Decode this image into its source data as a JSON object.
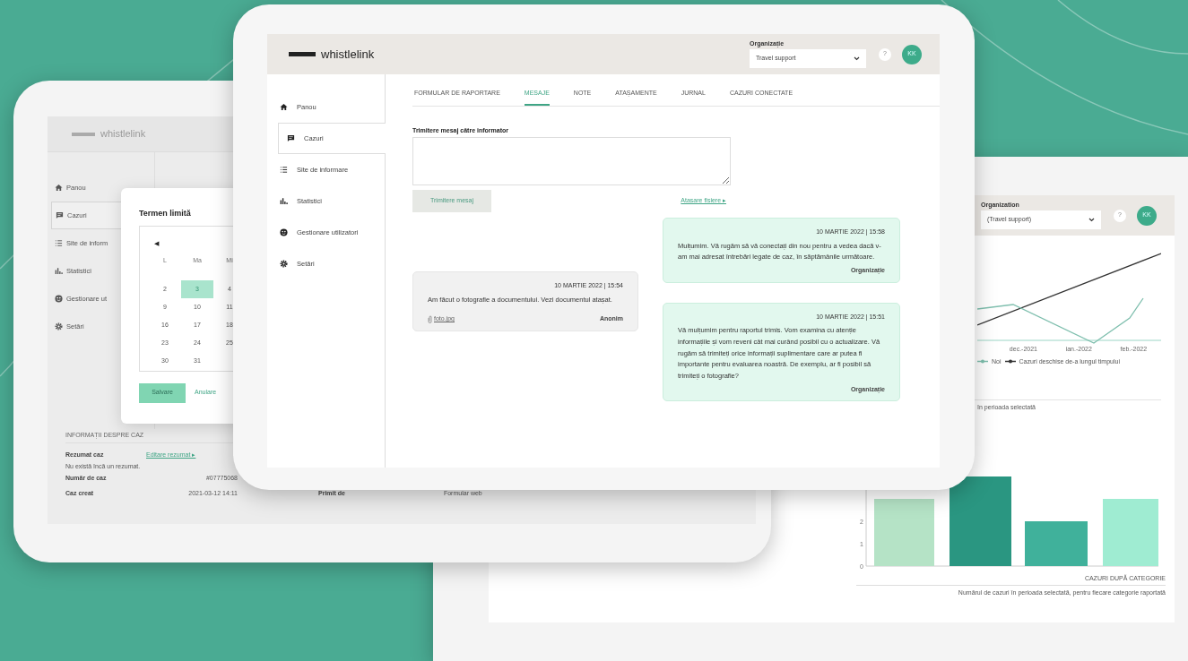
{
  "left_tablet": {
    "logo": "whistlelink",
    "sidebar": [
      {
        "label": "Panou",
        "selected": false
      },
      {
        "label": "Cazuri",
        "selected": true
      },
      {
        "label": "Site de inform",
        "selected": false
      },
      {
        "label": "Statistici",
        "selected": false
      },
      {
        "label": "Gestionare ut",
        "selected": false
      },
      {
        "label": "Setări",
        "selected": false
      }
    ],
    "dialog": {
      "title": "Termen limită",
      "prev": "◀",
      "weekdays": [
        "L",
        "Ma",
        "Mi"
      ],
      "weeks": [
        [
          {
            "day": "2",
            "selected": false
          },
          {
            "day": "3",
            "selected": true
          },
          {
            "day": "4",
            "selected": false
          }
        ],
        [
          {
            "day": "9",
            "selected": false
          },
          {
            "day": "10",
            "selected": false
          },
          {
            "day": "11",
            "selected": false
          }
        ],
        [
          {
            "day": "16",
            "selected": false
          },
          {
            "day": "17",
            "selected": false
          },
          {
            "day": "18",
            "selected": false
          }
        ],
        [
          {
            "day": "23",
            "selected": false
          },
          {
            "day": "24",
            "selected": false
          },
          {
            "day": "25",
            "selected": false
          }
        ],
        [
          {
            "day": "30",
            "selected": false
          },
          {
            "day": "31",
            "selected": false
          }
        ]
      ],
      "buttons": [
        {
          "label": "Salvare",
          "kind": "primary"
        },
        {
          "label": "Anulare",
          "kind": "link"
        }
      ]
    },
    "case_info": {
      "heading": "INFORMAȚII DESPRE CAZ",
      "summary_label": "Rezumat caz",
      "summary_link": "Editare rezumat ▸",
      "summary_note": "Nu există încă un rezumat.",
      "fields": [
        {
          "label": "Număr de caz",
          "value": "#07775068"
        },
        {
          "label": "Caz creat",
          "value": "2021-03-12 14:11"
        }
      ],
      "received": {
        "label": "Primit de",
        "value": "Formular web"
      }
    }
  },
  "front_tablet": {
    "logo": "whistlelink",
    "organization": {
      "label": "Organizație",
      "value": "Travel support"
    },
    "help": "?",
    "avatar": "KK",
    "sidebar": [
      {
        "label": "Panou",
        "selected": false
      },
      {
        "label": "Cazuri",
        "selected": true
      },
      {
        "label": "Site de informare",
        "selected": false
      },
      {
        "label": "Statistici",
        "selected": false
      },
      {
        "label": "Gestionare utilizatori",
        "selected": false
      },
      {
        "label": "Setări",
        "selected": false
      }
    ],
    "tabs": [
      {
        "label": "FORMULAR DE RAPORTARE",
        "selected": false
      },
      {
        "label": "MESAJE",
        "selected": true
      },
      {
        "label": "NOTE",
        "selected": false
      },
      {
        "label": "ATAȘAMENTE",
        "selected": false
      },
      {
        "label": "JURNAL",
        "selected": false
      },
      {
        "label": "CAZURI CONECTATE",
        "selected": false
      }
    ],
    "compose": {
      "label": "Trimitere mesaj către informator",
      "button": "Trimitere mesaj",
      "attach_link": "Atașare fișiere ▸"
    },
    "messages": [
      {
        "kind": "organization",
        "date": "10 MARTIE 2022 | 15:58",
        "text": "Mulțumim. Vă rugăm să vă conectați din nou pentru a vedea dacă v-am mai adresat întrebări legate de caz, în săptămânile următoare.",
        "sender": "Organizație"
      },
      {
        "kind": "anonymous",
        "date": "10 MARTIE 2022 | 15:54",
        "text": "Am făcut o fotografie a documentului. Vezi documentul atașat.",
        "attachment": "foto.jpg",
        "sender": "Anonim"
      },
      {
        "kind": "organization",
        "date": "10 MARTIE 2022 | 15:51",
        "text": "Vă mulțumim pentru raportul trimis. Vom examina cu atenție informațiile și vom reveni cât mai curând posibil cu o actualizare. Vă rugăm să trimiteți orice informații suplimentare care ar putea fi importante pentru evaluarea noastră. De exemplu, ar fi posibil să trimiteți o fotografie?",
        "sender": "Organizație"
      }
    ]
  },
  "right_tablet": {
    "organization": {
      "label": "Organization",
      "value": "(Travel support)"
    },
    "help": "?",
    "avatar": "KK",
    "trend_chart": {
      "x_labels": [
        "dec.-2021",
        "ian.-2022",
        "feb.-2022"
      ],
      "legend": [
        {
          "label": "Noi",
          "color": "#7fbfae"
        },
        {
          "label": "Cazuri deschise de-a lungul timpului",
          "color": "#333333"
        }
      ]
    },
    "category_chart": {
      "chart_data": {
        "type": "bar",
        "title": "în perioada selectată",
        "xlabel": "CAZURI DUPĂ CATEGORIE",
        "values": [
          3,
          4,
          2,
          3
        ],
        "colors": [
          "#b5e3c6",
          "#2a9681",
          "#40b19b",
          "#9fecd2"
        ],
        "ylim": [
          0,
          4
        ],
        "yticks": [
          0,
          1,
          2
        ]
      },
      "footnote": "Numărul de cazuri în perioada selectată, pentru fiecare categorie raportată"
    }
  }
}
